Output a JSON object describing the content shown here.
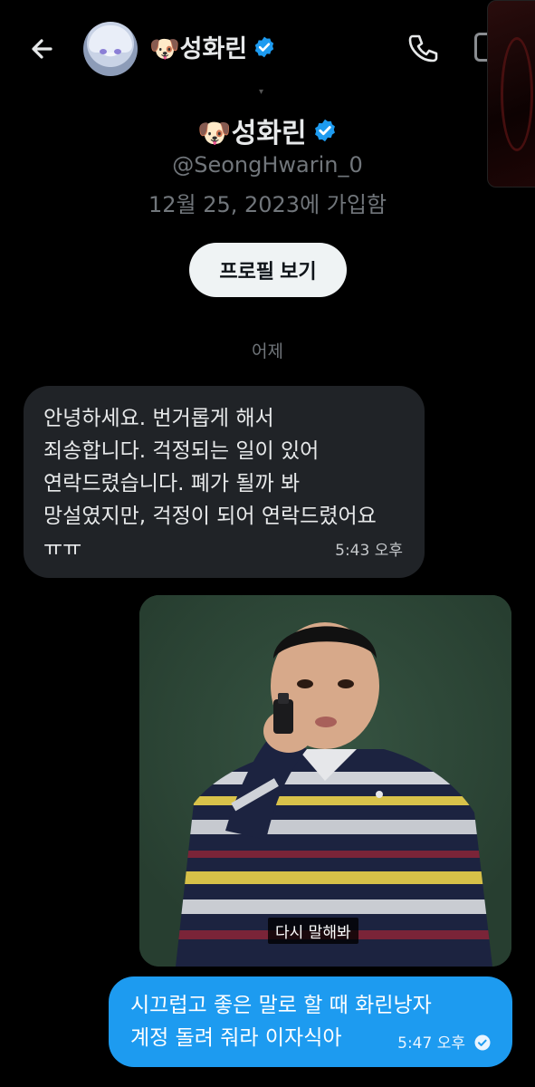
{
  "header": {
    "name": "🐶성화린",
    "back_icon": "arrow-left-icon",
    "call_icon": "phone-icon"
  },
  "profile": {
    "name": "🐶성화린",
    "handle": "@SeongHwarin_0",
    "joined": "12월 25, 2023에 가입함",
    "view_profile_label": "프로필 보기"
  },
  "conversation": {
    "date_separator": "어제",
    "messages": [
      {
        "direction": "incoming",
        "text": "안녕하세요. 번거롭게 해서\n죄송합니다. 걱정되는 일이 있어\n연락드렸습니다. 폐가 될까 봐\n망설였지만, 걱정이 되어 연락드렸어요\nㅠㅠ",
        "time": "5:43 오후"
      },
      {
        "direction": "outgoing",
        "type": "image",
        "image_caption": "다시 말해봐"
      },
      {
        "direction": "outgoing",
        "text": "시끄럽고 좋은 말로 할 때 화린낭자\n계정 돌려 줘라 이자식아",
        "time": "5:47 오후",
        "status_icon": "read-check-icon"
      }
    ]
  },
  "colors": {
    "background": "#000000",
    "incoming_bubble": "#202327",
    "outgoing_bubble": "#1d9bf0",
    "verified": "#1d9bf0",
    "muted_text": "#71767b"
  }
}
